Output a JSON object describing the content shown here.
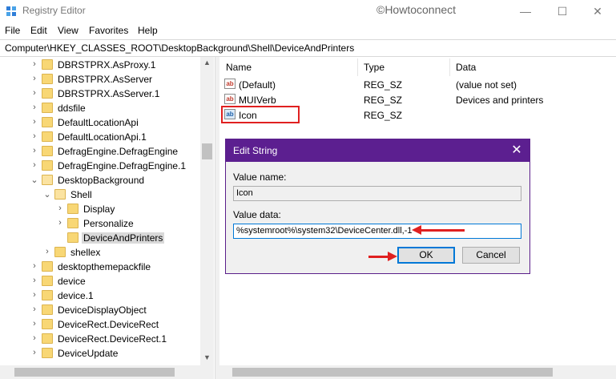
{
  "window": {
    "title": "Registry Editor",
    "watermark": "©Howtoconnect",
    "minimize_glyph": "—",
    "maximize_glyph": "☐",
    "close_glyph": "✕"
  },
  "menu": [
    "File",
    "Edit",
    "View",
    "Favorites",
    "Help"
  ],
  "address": "Computer\\HKEY_CLASSES_ROOT\\DesktopBackground\\Shell\\DeviceAndPrinters",
  "tree": [
    {
      "label": "DBRSTPRX.AsProxy.1",
      "level": 0,
      "chevron": "›"
    },
    {
      "label": "DBRSTPRX.AsServer",
      "level": 0,
      "chevron": "›"
    },
    {
      "label": "DBRSTPRX.AsServer.1",
      "level": 0,
      "chevron": "›"
    },
    {
      "label": "ddsfile",
      "level": 0,
      "chevron": "›"
    },
    {
      "label": "DefaultLocationApi",
      "level": 0,
      "chevron": "›"
    },
    {
      "label": "DefaultLocationApi.1",
      "level": 0,
      "chevron": "›"
    },
    {
      "label": "DefragEngine.DefragEngine",
      "level": 0,
      "chevron": "›"
    },
    {
      "label": "DefragEngine.DefragEngine.1",
      "level": 0,
      "chevron": "›"
    },
    {
      "label": "DesktopBackground",
      "level": 0,
      "chevron": "⌄"
    },
    {
      "label": "Shell",
      "level": 1,
      "chevron": "⌄"
    },
    {
      "label": "Display",
      "level": 2,
      "chevron": "›"
    },
    {
      "label": "Personalize",
      "level": 2,
      "chevron": "›"
    },
    {
      "label": "DeviceAndPrinters",
      "level": 2,
      "chevron": "",
      "selected": true
    },
    {
      "label": "shellex",
      "level": 1,
      "chevron": "›"
    },
    {
      "label": "desktopthemepackfile",
      "level": 0,
      "chevron": "›"
    },
    {
      "label": "device",
      "level": 0,
      "chevron": "›"
    },
    {
      "label": "device.1",
      "level": 0,
      "chevron": "›"
    },
    {
      "label": "DeviceDisplayObject",
      "level": 0,
      "chevron": "›"
    },
    {
      "label": "DeviceRect.DeviceRect",
      "level": 0,
      "chevron": "›"
    },
    {
      "label": "DeviceRect.DeviceRect.1",
      "level": 0,
      "chevron": "›"
    },
    {
      "label": "DeviceUpdate",
      "level": 0,
      "chevron": "›"
    }
  ],
  "list": {
    "columns": [
      "Name",
      "Type",
      "Data"
    ],
    "rows": [
      {
        "name": "(Default)",
        "type": "REG_SZ",
        "data": "(value not set)"
      },
      {
        "name": "MUIVerb",
        "type": "REG_SZ",
        "data": "Devices and printers"
      },
      {
        "name": "Icon",
        "type": "REG_SZ",
        "data": ""
      }
    ]
  },
  "dialog": {
    "title": "Edit String",
    "value_name_label": "Value name:",
    "value_name": "Icon",
    "value_data_label": "Value data:",
    "value_data": "%systemroot%\\system32\\DeviceCenter.dll,-1",
    "ok_label": "OK",
    "cancel_label": "Cancel",
    "close_glyph": "✕"
  },
  "icons": {
    "string_value": "ab",
    "up_arrow": "▲",
    "down_arrow": "▼",
    "annotation_color": "#e02020",
    "dialog_titlebar_color": "#5c1f90"
  }
}
